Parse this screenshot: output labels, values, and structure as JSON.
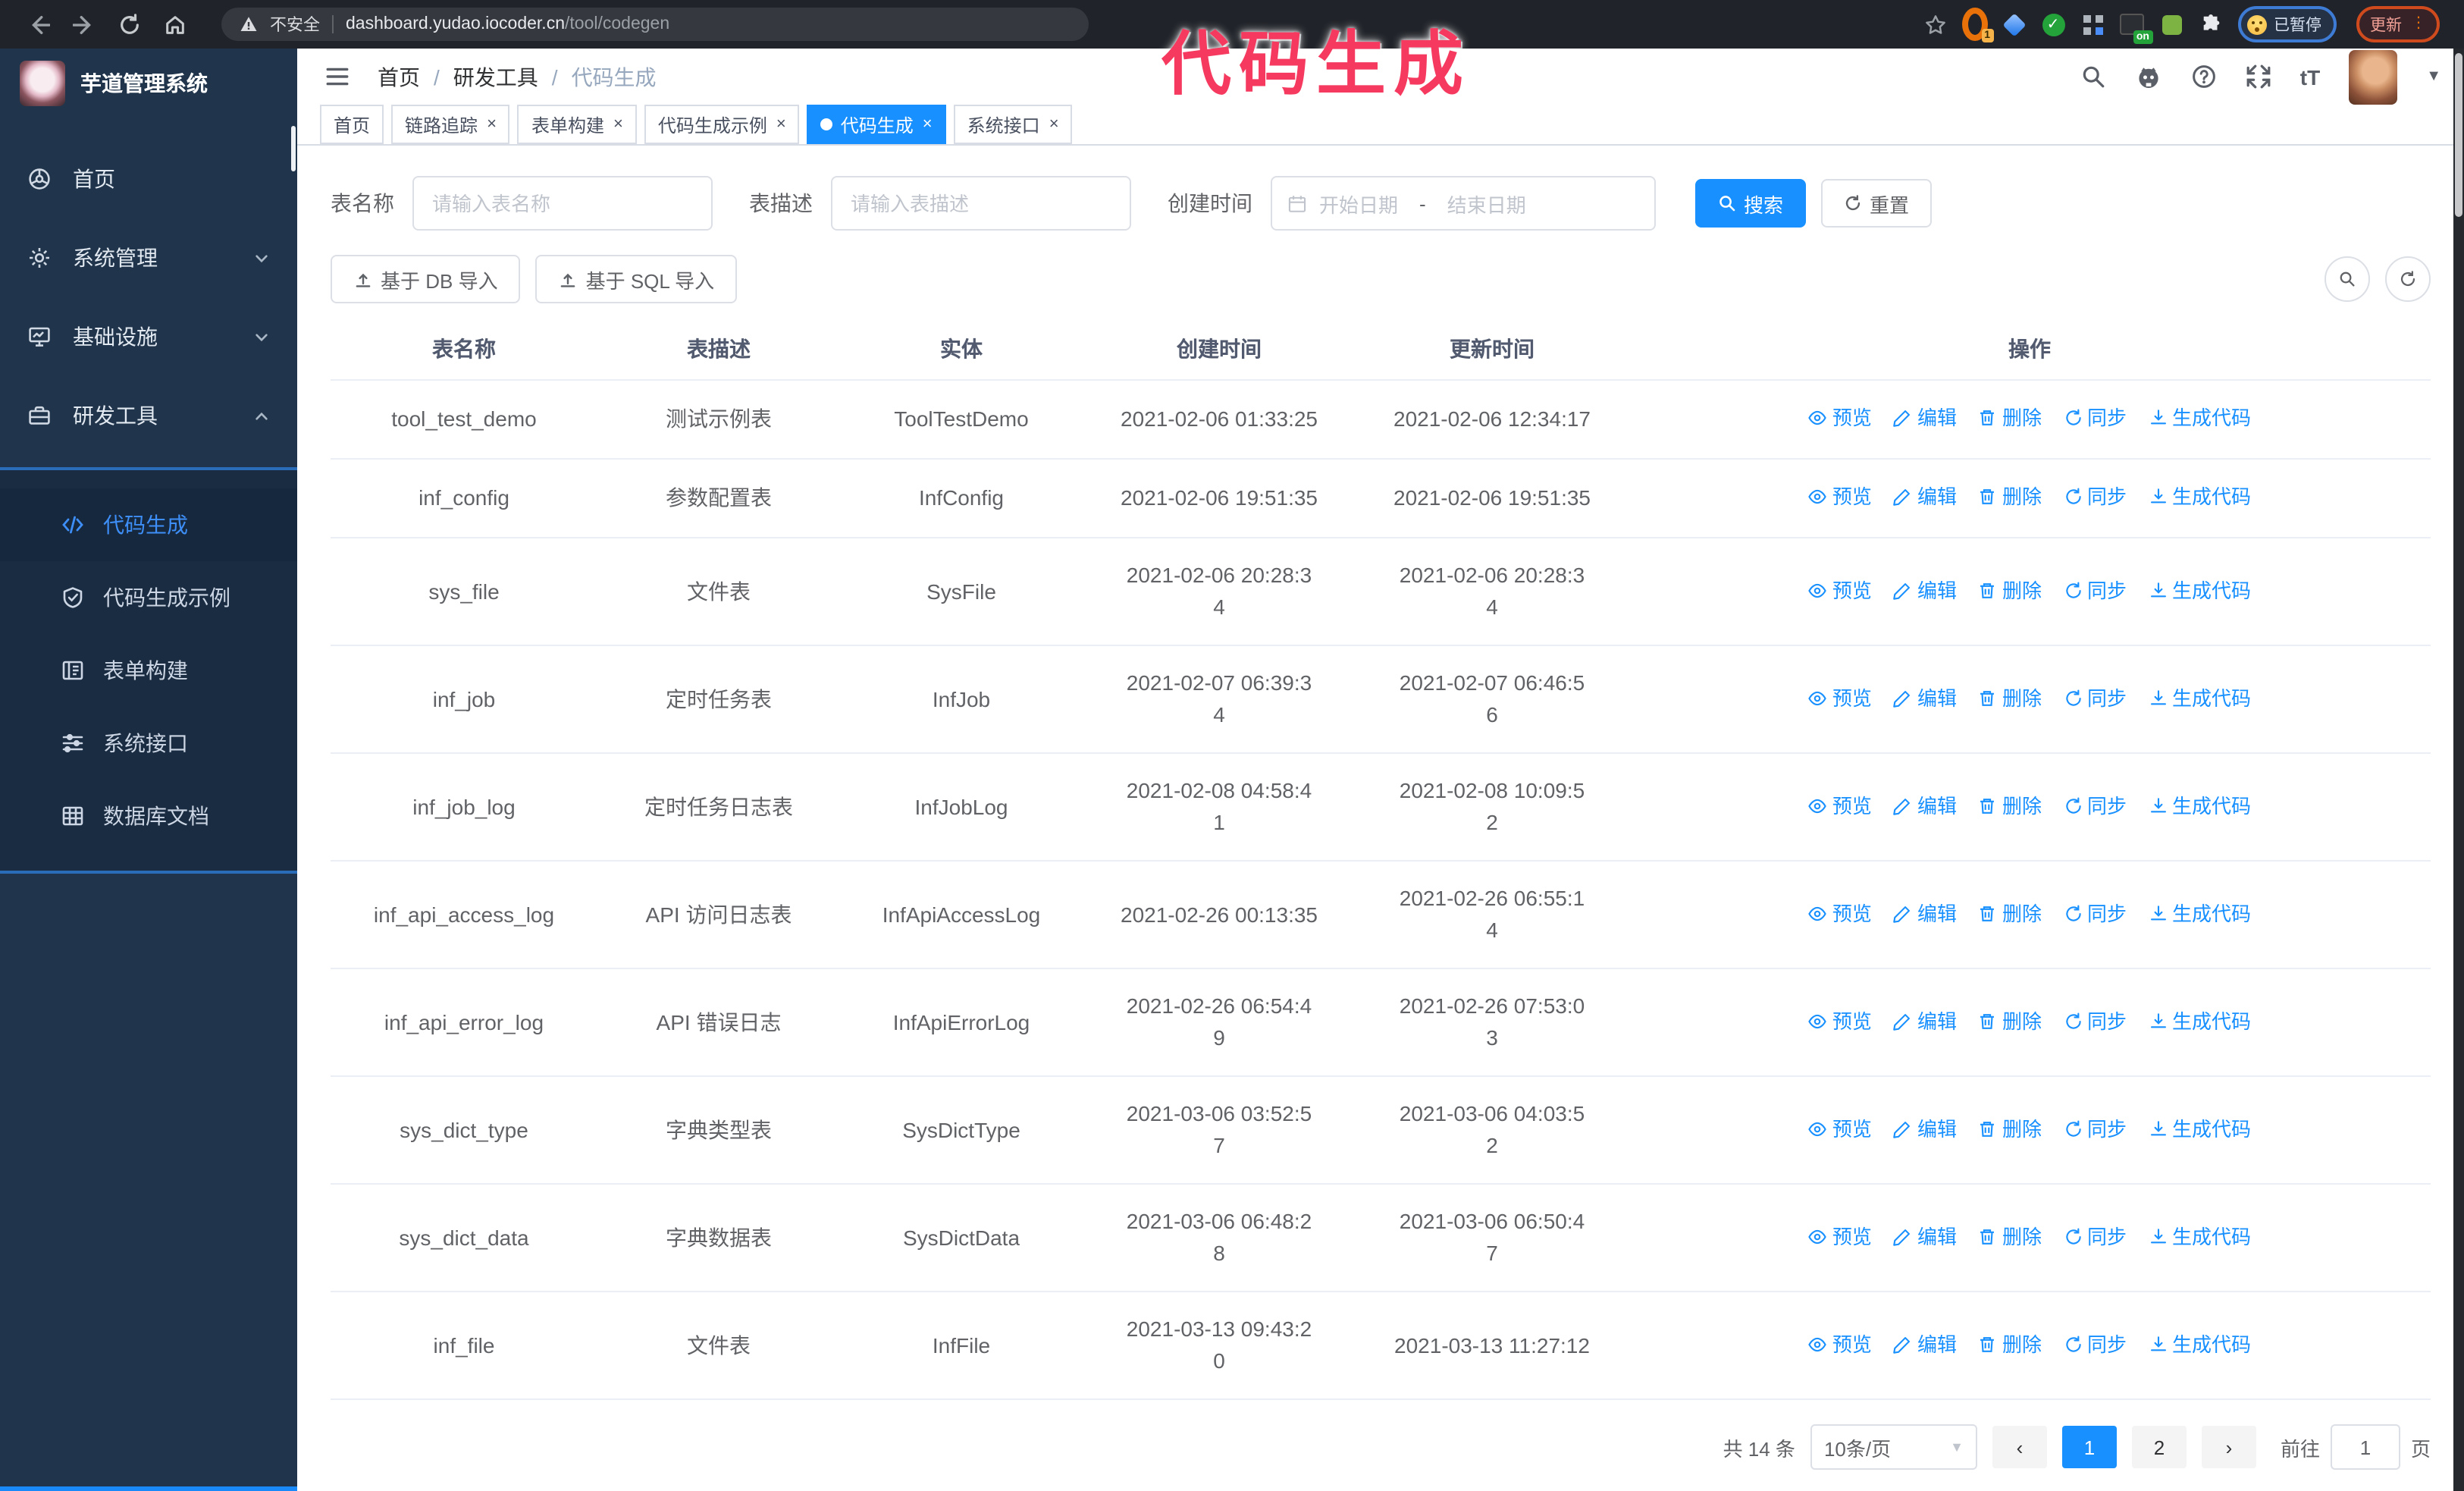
{
  "colors": {
    "accent": "#1890ff",
    "chrome": "#202329",
    "urlbar": "#35383f",
    "sidebar": "#20354c",
    "submenu": "#1a2c41",
    "subborder": "#2b6cb8",
    "subactive": "#16283d",
    "activetext": "#3e8ef7",
    "annot": "#f5395f"
  },
  "annotation": {
    "text": "代码生成"
  },
  "browser": {
    "security_label": "不安全",
    "url_host": "dashboard.yudao.iocoder.cn",
    "url_path": "/tool/codegen",
    "ext_badge": "1",
    "on_badge": "on",
    "paused_badge": "已暂停",
    "update_button": "更新"
  },
  "sidebar": {
    "title": "芋道管理系统",
    "items": [
      {
        "label": "首页",
        "icon": "dashboard-icon",
        "chevron": ""
      },
      {
        "label": "系统管理",
        "icon": "gear-icon",
        "chevron": "down"
      },
      {
        "label": "基础设施",
        "icon": "monitor-icon",
        "chevron": "down"
      },
      {
        "label": "研发工具",
        "icon": "toolbox-icon",
        "chevron": "up"
      }
    ],
    "submenu": [
      {
        "label": "代码生成",
        "icon": "code-icon",
        "active": true
      },
      {
        "label": "代码生成示例",
        "icon": "badge-check-icon",
        "active": false
      },
      {
        "label": "表单构建",
        "icon": "form-icon",
        "active": false
      },
      {
        "label": "系统接口",
        "icon": "sliders-icon",
        "active": false
      },
      {
        "label": "数据库文档",
        "icon": "table-grid-icon",
        "active": false
      }
    ]
  },
  "header": {
    "breadcrumb": [
      "首页",
      "研发工具",
      "代码生成"
    ]
  },
  "tabs": [
    {
      "label": "首页",
      "closable": false,
      "active": false
    },
    {
      "label": "链路追踪",
      "closable": true,
      "active": false
    },
    {
      "label": "表单构建",
      "closable": true,
      "active": false
    },
    {
      "label": "代码生成示例",
      "closable": true,
      "active": false
    },
    {
      "label": "代码生成",
      "closable": true,
      "active": true
    },
    {
      "label": "系统接口",
      "closable": true,
      "active": false
    }
  ],
  "filters": {
    "table_name_label": "表名称",
    "table_name_placeholder": "请输入表名称",
    "table_desc_label": "表描述",
    "table_desc_placeholder": "请输入表描述",
    "create_time_label": "创建时间",
    "date_start_placeholder": "开始日期",
    "date_separator": "-",
    "date_end_placeholder": "结束日期",
    "search_button": "搜索",
    "reset_button": "重置"
  },
  "toolbar": {
    "import_db_button": "基于 DB 导入",
    "import_sql_button": "基于 SQL 导入"
  },
  "table": {
    "columns": [
      "表名称",
      "表描述",
      "实体",
      "创建时间",
      "更新时间",
      "操作"
    ],
    "actions": [
      "预览",
      "编辑",
      "删除",
      "同步",
      "生成代码"
    ],
    "rows": [
      {
        "name": "tool_test_demo",
        "desc": "测试示例表",
        "entity": "ToolTestDemo",
        "created": [
          "2021-02-06 01:33:25"
        ],
        "updated": [
          "2021-02-06 12:34:17"
        ]
      },
      {
        "name": "inf_config",
        "desc": "参数配置表",
        "entity": "InfConfig",
        "created": [
          "2021-02-06 19:51:35"
        ],
        "updated": [
          "2021-02-06 19:51:35"
        ]
      },
      {
        "name": "sys_file",
        "desc": "文件表",
        "entity": "SysFile",
        "created": [
          "2021-02-06 20:28:3",
          "4"
        ],
        "updated": [
          "2021-02-06 20:28:3",
          "4"
        ]
      },
      {
        "name": "inf_job",
        "desc": "定时任务表",
        "entity": "InfJob",
        "created": [
          "2021-02-07 06:39:3",
          "4"
        ],
        "updated": [
          "2021-02-07 06:46:5",
          "6"
        ]
      },
      {
        "name": "inf_job_log",
        "desc": "定时任务日志表",
        "entity": "InfJobLog",
        "created": [
          "2021-02-08 04:58:4",
          "1"
        ],
        "updated": [
          "2021-02-08 10:09:5",
          "2"
        ]
      },
      {
        "name": "inf_api_access_log",
        "desc": "API 访问日志表",
        "entity": "InfApiAccessLog",
        "created": [
          "2021-02-26 00:13:35"
        ],
        "updated": [
          "2021-02-26 06:55:1",
          "4"
        ]
      },
      {
        "name": "inf_api_error_log",
        "desc": "API 错误日志",
        "entity": "InfApiErrorLog",
        "created": [
          "2021-02-26 06:54:4",
          "9"
        ],
        "updated": [
          "2021-02-26 07:53:0",
          "3"
        ]
      },
      {
        "name": "sys_dict_type",
        "desc": "字典类型表",
        "entity": "SysDictType",
        "created": [
          "2021-03-06 03:52:5",
          "7"
        ],
        "updated": [
          "2021-03-06 04:03:5",
          "2"
        ]
      },
      {
        "name": "sys_dict_data",
        "desc": "字典数据表",
        "entity": "SysDictData",
        "created": [
          "2021-03-06 06:48:2",
          "8"
        ],
        "updated": [
          "2021-03-06 06:50:4",
          "7"
        ]
      },
      {
        "name": "inf_file",
        "desc": "文件表",
        "entity": "InfFile",
        "created": [
          "2021-03-13 09:43:2",
          "0"
        ],
        "updated": [
          "2021-03-13 11:27:12"
        ]
      }
    ]
  },
  "pagination": {
    "total_text": "共 14 条",
    "page_size": "10条/页",
    "pages": [
      "1",
      "2"
    ],
    "active_page": "1",
    "goto_label": "前往",
    "goto_value": "1",
    "goto_suffix": "页"
  }
}
